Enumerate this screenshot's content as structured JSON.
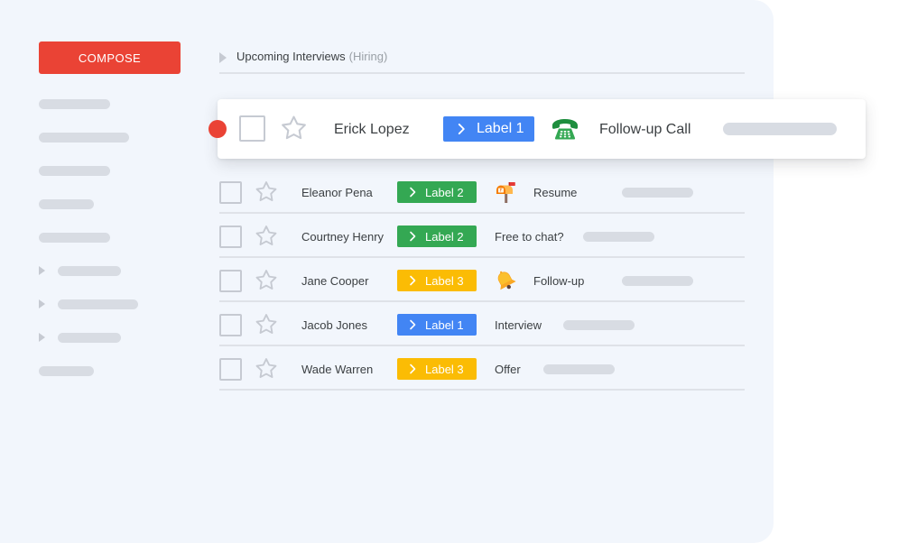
{
  "app": {
    "compose_label": "COMPOSE"
  },
  "section": {
    "title": "Upcoming Interviews",
    "subtitle": "(Hiring)"
  },
  "colors": {
    "compose": "#ea4335",
    "label_1": "#4285f4",
    "label_2": "#34a853",
    "label_3": "#fbbc04",
    "unread_dot": "#ea4335"
  },
  "highlighted": {
    "name": "Erick Lopez",
    "label": "Label 1",
    "icon": "phone-icon",
    "subject": "Follow-up Call"
  },
  "rows": [
    {
      "name": "Eleanor Pena",
      "label": "Label 2",
      "icon": "mailbox-icon",
      "subject": "Resume"
    },
    {
      "name": "Courtney Henry",
      "label": "Label 2",
      "icon": "",
      "subject": "Free to chat?"
    },
    {
      "name": "Jane Cooper",
      "label": "Label 3",
      "icon": "bell-icon",
      "subject": "Follow-up"
    },
    {
      "name": "Jacob Jones",
      "label": "Label 1",
      "icon": "",
      "subject": "Interview"
    },
    {
      "name": "Wade Warren",
      "label": "Label 3",
      "icon": "",
      "subject": "Offer"
    }
  ]
}
